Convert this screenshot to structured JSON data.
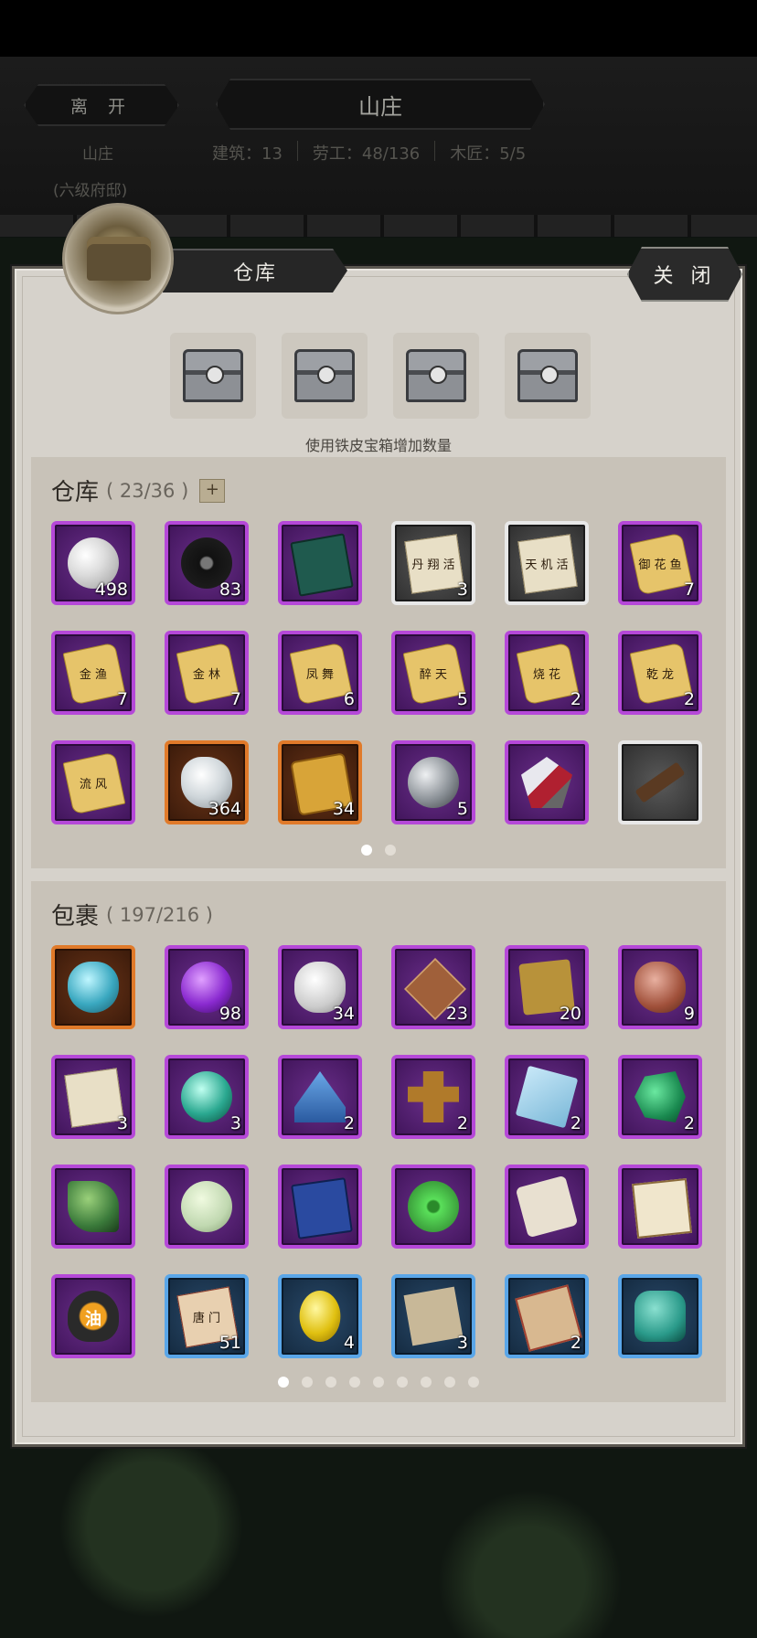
{
  "top": {
    "leave_label": "离 开",
    "title": "山庄",
    "subtitle_line1": "山庄",
    "subtitle_line2": "(六级府邸)",
    "stats": [
      "建筑：13",
      "劳工：48/136",
      "木匠：5/5"
    ]
  },
  "dialog": {
    "tab_label": "仓库",
    "close_label": "关 闭",
    "chest_hint": "使用铁皮宝箱增加数量",
    "chest_count": 4
  },
  "warehouse": {
    "title": "仓库",
    "count": "( 23/36 )",
    "plus": "+",
    "page": 1,
    "pages": 2,
    "items": [
      {
        "icon": "pearl-icon",
        "rarity": "purple",
        "count": "498"
      },
      {
        "icon": "black-jade-disc-icon",
        "rarity": "purple",
        "count": "83"
      },
      {
        "icon": "green-book-icon",
        "rarity": "purple",
        "count": ""
      },
      {
        "icon": "paper-scroll-icon",
        "rarity": "white",
        "count": "3",
        "text": "丹 翔 活"
      },
      {
        "icon": "paper-scroll-icon",
        "rarity": "white",
        "count": "",
        "text": "天 机 活"
      },
      {
        "icon": "yellow-scroll-icon",
        "rarity": "purple",
        "count": "7",
        "text": "御 花 鱼"
      },
      {
        "icon": "yellow-scroll-icon",
        "rarity": "purple",
        "count": "7",
        "text": "金 渔"
      },
      {
        "icon": "yellow-scroll-icon",
        "rarity": "purple",
        "count": "7",
        "text": "金 林"
      },
      {
        "icon": "yellow-scroll-icon",
        "rarity": "purple",
        "count": "6",
        "text": "凤 舞"
      },
      {
        "icon": "yellow-scroll-icon",
        "rarity": "purple",
        "count": "5",
        "text": "醉 天"
      },
      {
        "icon": "yellow-scroll-icon",
        "rarity": "purple",
        "count": "2",
        "text": "烧 花"
      },
      {
        "icon": "yellow-scroll-icon",
        "rarity": "purple",
        "count": "2",
        "text": "乾 龙"
      },
      {
        "icon": "yellow-scroll-icon",
        "rarity": "purple",
        "count": "",
        "text": "流 风"
      },
      {
        "icon": "silver-ingot-icon",
        "rarity": "orange",
        "count": "364"
      },
      {
        "icon": "gold-token-icon",
        "rarity": "orange",
        "count": "34"
      },
      {
        "icon": "iron-ball-icon",
        "rarity": "purple",
        "count": "5"
      },
      {
        "icon": "crystal-ore-icon",
        "rarity": "purple",
        "count": ""
      },
      {
        "icon": "wooden-stick-icon",
        "rarity": "white",
        "count": ""
      }
    ]
  },
  "bag": {
    "title": "包裹",
    "count": "( 197/216 )",
    "page": 1,
    "pages": 9,
    "items": [
      {
        "icon": "turquoise-stone-icon",
        "rarity": "orange",
        "count": ""
      },
      {
        "icon": "violet-pill-icon",
        "rarity": "purple",
        "count": "98"
      },
      {
        "icon": "white-cotton-icon",
        "rarity": "purple",
        "count": "34"
      },
      {
        "icon": "talisman-mat-icon",
        "rarity": "purple",
        "count": "23"
      },
      {
        "icon": "gold-plate-icon",
        "rarity": "purple",
        "count": "20"
      },
      {
        "icon": "red-stone-icon",
        "rarity": "purple",
        "count": "9"
      },
      {
        "icon": "letter-paper-icon",
        "rarity": "purple",
        "count": "3"
      },
      {
        "icon": "teal-pearl-icon",
        "rarity": "purple",
        "count": "3"
      },
      {
        "icon": "blue-sand-icon",
        "rarity": "purple",
        "count": "2"
      },
      {
        "icon": "puppet-icon",
        "rarity": "purple",
        "count": "2"
      },
      {
        "icon": "ice-crystal-icon",
        "rarity": "purple",
        "count": "2"
      },
      {
        "icon": "jade-ore-icon",
        "rarity": "purple",
        "count": "2"
      },
      {
        "icon": "green-leaf-stone-icon",
        "rarity": "purple",
        "count": ""
      },
      {
        "icon": "jade-disc-icon",
        "rarity": "purple",
        "count": ""
      },
      {
        "icon": "blue-book-icon",
        "rarity": "purple",
        "count": ""
      },
      {
        "icon": "green-pendant-icon",
        "rarity": "purple",
        "count": ""
      },
      {
        "icon": "paper-roll-icon",
        "rarity": "purple",
        "count": ""
      },
      {
        "icon": "book-stack-icon",
        "rarity": "purple",
        "count": ""
      },
      {
        "icon": "oil-jar-icon",
        "rarity": "purple",
        "count": "",
        "text": "油"
      },
      {
        "icon": "tang-sect-card-icon",
        "rarity": "blue",
        "count": "51",
        "text": "唐 门"
      },
      {
        "icon": "gold-egg-icon",
        "rarity": "blue",
        "count": "4"
      },
      {
        "icon": "old-paper-icon",
        "rarity": "blue",
        "count": "3"
      },
      {
        "icon": "red-scroll-icon",
        "rarity": "blue",
        "count": "2"
      },
      {
        "icon": "jade-tablet-icon",
        "rarity": "blue",
        "count": ""
      }
    ]
  }
}
